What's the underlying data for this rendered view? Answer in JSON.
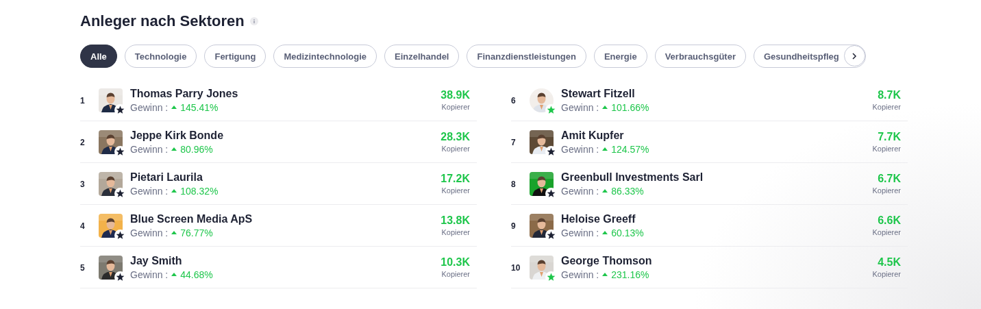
{
  "title": "Anleger nach Sektoren",
  "sectors": [
    {
      "label": "Alle",
      "selected": true
    },
    {
      "label": "Technologie",
      "selected": false
    },
    {
      "label": "Fertigung",
      "selected": false
    },
    {
      "label": "Medizintechnologie",
      "selected": false
    },
    {
      "label": "Einzelhandel",
      "selected": false
    },
    {
      "label": "Finanzdienstleistungen",
      "selected": false
    },
    {
      "label": "Energie",
      "selected": false
    },
    {
      "label": "Verbrauchsgüter",
      "selected": false
    },
    {
      "label": "Gesundheitspfleg",
      "selected": false
    }
  ],
  "investors": [
    {
      "rank": "1",
      "name": "Thomas Parry Jones",
      "gain_label": "Gewinn :",
      "gain": "145.41%",
      "copiers": "38.9K",
      "copiers_label": "Kopierer",
      "kind": "square",
      "color": "#1d2133"
    },
    {
      "rank": "2",
      "name": "Jeppe Kirk Bonde",
      "gain_label": "Gewinn :",
      "gain": "80.96%",
      "copiers": "28.3K",
      "copiers_label": "Kopierer",
      "kind": "square",
      "color": "#1d2133"
    },
    {
      "rank": "3",
      "name": "Pietari Laurila",
      "gain_label": "Gewinn :",
      "gain": "108.32%",
      "copiers": "17.2K",
      "copiers_label": "Kopierer",
      "kind": "square",
      "color": "#1d2133"
    },
    {
      "rank": "4",
      "name": "Blue Screen Media ApS",
      "gain_label": "Gewinn :",
      "gain": "76.77%",
      "copiers": "13.8K",
      "copiers_label": "Kopierer",
      "kind": "square",
      "color": "#1d2133"
    },
    {
      "rank": "5",
      "name": "Jay Smith",
      "gain_label": "Gewinn :",
      "gain": "44.68%",
      "copiers": "10.3K",
      "copiers_label": "Kopierer",
      "kind": "square",
      "color": "#1d2133"
    },
    {
      "rank": "6",
      "name": "Stewart Fitzell",
      "gain_label": "Gewinn :",
      "gain": "101.66%",
      "copiers": "8.7K",
      "copiers_label": "Kopierer",
      "kind": "circle",
      "color": "#1ec64b"
    },
    {
      "rank": "7",
      "name": "Amit Kupfer",
      "gain_label": "Gewinn :",
      "gain": "124.57%",
      "copiers": "7.7K",
      "copiers_label": "Kopierer",
      "kind": "square",
      "color": "#1d2133"
    },
    {
      "rank": "8",
      "name": "Greenbull Investments Sarl",
      "gain_label": "Gewinn :",
      "gain": "86.33%",
      "copiers": "6.7K",
      "copiers_label": "Kopierer",
      "kind": "square",
      "color": "#1d2133"
    },
    {
      "rank": "9",
      "name": "Heloise Greeff",
      "gain_label": "Gewinn :",
      "gain": "60.13%",
      "copiers": "6.6K",
      "copiers_label": "Kopierer",
      "kind": "square",
      "color": "#1d2133"
    },
    {
      "rank": "10",
      "name": "George Thomson",
      "gain_label": "Gewinn :",
      "gain": "231.16%",
      "copiers": "4.5K",
      "copiers_label": "Kopierer",
      "kind": "square",
      "color": "#1ec64b"
    }
  ]
}
